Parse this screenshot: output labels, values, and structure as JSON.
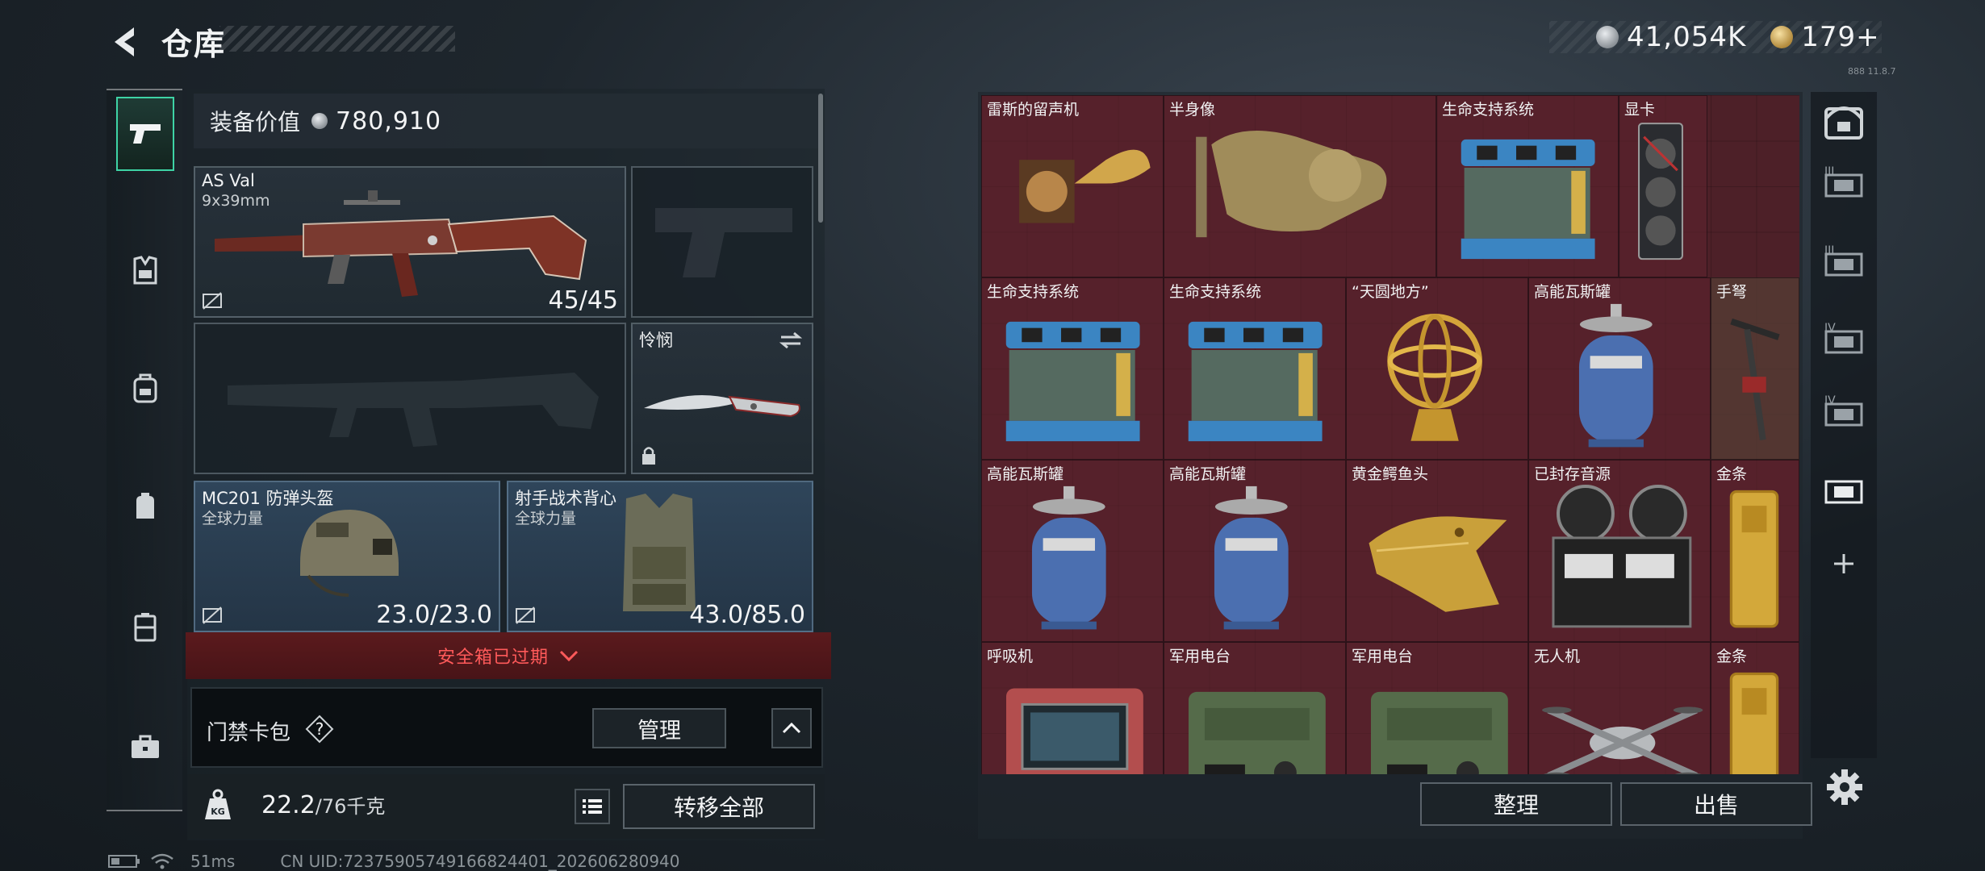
{
  "title": "仓库",
  "currency": {
    "silver": "41,054K",
    "gold": "179+"
  },
  "version": "888 11.8.7",
  "equipment": {
    "label": "装备价值",
    "value": "780,910"
  },
  "slots": {
    "primary": {
      "name": "AS Val",
      "ammo": "9x39mm",
      "count": "45/45"
    },
    "melee": {
      "name": "怜悯"
    },
    "helmet": {
      "name": "MC201 防弹头盔",
      "faction": "全球力量",
      "durability": "23.0/23.0"
    },
    "vest": {
      "name": "射手战术背心",
      "faction": "全球力量",
      "durability": "43.0/85.0"
    }
  },
  "safebox": {
    "expired_text": "安全箱已过期"
  },
  "keycard": {
    "label": "门禁卡包",
    "help": "?",
    "manage": "管理"
  },
  "weight": {
    "current": "22.2",
    "max": "/76千克",
    "transfer": "转移全部"
  },
  "stash_items": [
    {
      "name": "雷斯的留声机",
      "icon": "gramophone"
    },
    {
      "name": "半身像",
      "icon": "bust"
    },
    {
      "name": "生命支持系统",
      "icon": "life-support"
    },
    {
      "name": "显卡",
      "icon": "gpu"
    },
    {
      "name": "生命支持系统",
      "icon": "life-support"
    },
    {
      "name": "生命支持系统",
      "icon": "life-support"
    },
    {
      "name": "“天圆地方”",
      "icon": "armillary"
    },
    {
      "name": "高能瓦斯罐",
      "icon": "gas-canister"
    },
    {
      "name": "手弩",
      "icon": "crossbow"
    },
    {
      "name": "高能瓦斯罐",
      "icon": "gas-canister"
    },
    {
      "name": "高能瓦斯罐",
      "icon": "gas-canister"
    },
    {
      "name": "黄金鳄鱼头",
      "icon": "gold-croc"
    },
    {
      "name": "已封存音源",
      "icon": "tape-recorder"
    },
    {
      "name": "金条",
      "icon": "gold-bar"
    },
    {
      "name": "呼吸机",
      "icon": "ventilator"
    },
    {
      "name": "军用电台",
      "icon": "radio"
    },
    {
      "name": "军用电台",
      "icon": "radio"
    },
    {
      "name": "无人机",
      "icon": "drone"
    },
    {
      "name": "金条",
      "icon": "gold-bar"
    }
  ],
  "stash_actions": {
    "tidy": "整理",
    "sell": "出售"
  },
  "right_tabs": [
    "vault-icon",
    "stash-1-icon",
    "stash-2-icon",
    "stash-3-icon",
    "stash-4-icon",
    "stash-5-icon",
    "add-icon"
  ],
  "right_tab_labels": [
    "",
    "III",
    "III",
    "IV",
    "IV",
    "",
    "+"
  ],
  "status": {
    "ping": "51ms",
    "uid": "CN UID:72375905749166824401_202606280940"
  },
  "colors": {
    "accent": "#3ed3a5",
    "expired": "#ff5a5a",
    "stash_bg": "#4d2028"
  }
}
